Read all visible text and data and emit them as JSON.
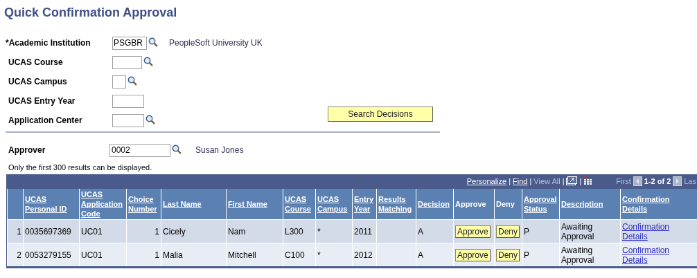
{
  "page_title": "Quick Confirmation Approval",
  "fields": [
    {
      "label": "*Academic Institution",
      "value": "PSGBR",
      "lookup": true,
      "description": "PeopleSoft University UK"
    },
    {
      "label": "UCAS Course",
      "lookup": true
    },
    {
      "label": "UCAS Campus",
      "lookup": true
    },
    {
      "label": "UCAS Entry Year",
      "lookup": false
    },
    {
      "label": "Application Center",
      "lookup": true
    }
  ],
  "search_button": "Search Decisions",
  "approver": {
    "label": "Approver",
    "value": "0002",
    "lookup": true,
    "description": "Susan Jones"
  },
  "note": "Only the first 300 results can be displayed.",
  "grid": {
    "toolbar": {
      "separator": "|",
      "personalize": "Personalize",
      "find": "Find",
      "view_all": "View All",
      "first": "First",
      "range": "1-2 of 2",
      "last": "Las"
    },
    "columns": [
      "",
      "UCAS Personal ID",
      "UCAS Application Code",
      "Choice Number",
      "Last Name",
      "First Name",
      "UCAS Course",
      "UCAS Campus",
      "Entry Year",
      "Results Matching",
      "Decision",
      "Approve",
      "Deny",
      "Approval Status",
      "Description",
      "Confirmation Details"
    ],
    "rows": [
      {
        "row_number": "1",
        "personal_id": "0035697369",
        "application_code": "UC01",
        "choice_number": "1",
        "last_name": "Cicely",
        "first_name": "Nam",
        "course": "L300",
        "campus": "*",
        "entry_year": "2011",
        "decision": "A",
        "approve": "Approve",
        "deny": "Deny",
        "approval_status": "P",
        "description": "Awaiting Approval",
        "details_link": "Confirmation Details"
      },
      {
        "row_number": "2",
        "personal_id": "0053279155",
        "application_code": "UC01",
        "choice_number": "1",
        "last_name": "Malia",
        "first_name": "Mitchell",
        "course": "C100",
        "campus": "*",
        "entry_year": "2012",
        "decision": "A",
        "approve": "Approve",
        "deny": "Deny",
        "approval_status": "P",
        "description": "Awaiting Approval",
        "details_link": "Confirmation Details"
      }
    ]
  }
}
